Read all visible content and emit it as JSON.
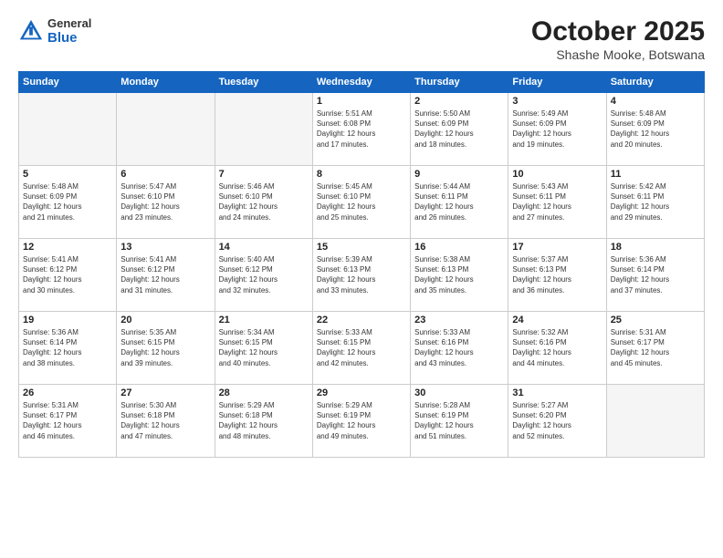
{
  "header": {
    "logo_general": "General",
    "logo_blue": "Blue",
    "month_title": "October 2025",
    "location": "Shashe Mooke, Botswana"
  },
  "days_of_week": [
    "Sunday",
    "Monday",
    "Tuesday",
    "Wednesday",
    "Thursday",
    "Friday",
    "Saturday"
  ],
  "weeks": [
    [
      {
        "day": "",
        "info": ""
      },
      {
        "day": "",
        "info": ""
      },
      {
        "day": "",
        "info": ""
      },
      {
        "day": "1",
        "info": "Sunrise: 5:51 AM\nSunset: 6:08 PM\nDaylight: 12 hours\nand 17 minutes."
      },
      {
        "day": "2",
        "info": "Sunrise: 5:50 AM\nSunset: 6:09 PM\nDaylight: 12 hours\nand 18 minutes."
      },
      {
        "day": "3",
        "info": "Sunrise: 5:49 AM\nSunset: 6:09 PM\nDaylight: 12 hours\nand 19 minutes."
      },
      {
        "day": "4",
        "info": "Sunrise: 5:48 AM\nSunset: 6:09 PM\nDaylight: 12 hours\nand 20 minutes."
      }
    ],
    [
      {
        "day": "5",
        "info": "Sunrise: 5:48 AM\nSunset: 6:09 PM\nDaylight: 12 hours\nand 21 minutes."
      },
      {
        "day": "6",
        "info": "Sunrise: 5:47 AM\nSunset: 6:10 PM\nDaylight: 12 hours\nand 23 minutes."
      },
      {
        "day": "7",
        "info": "Sunrise: 5:46 AM\nSunset: 6:10 PM\nDaylight: 12 hours\nand 24 minutes."
      },
      {
        "day": "8",
        "info": "Sunrise: 5:45 AM\nSunset: 6:10 PM\nDaylight: 12 hours\nand 25 minutes."
      },
      {
        "day": "9",
        "info": "Sunrise: 5:44 AM\nSunset: 6:11 PM\nDaylight: 12 hours\nand 26 minutes."
      },
      {
        "day": "10",
        "info": "Sunrise: 5:43 AM\nSunset: 6:11 PM\nDaylight: 12 hours\nand 27 minutes."
      },
      {
        "day": "11",
        "info": "Sunrise: 5:42 AM\nSunset: 6:11 PM\nDaylight: 12 hours\nand 29 minutes."
      }
    ],
    [
      {
        "day": "12",
        "info": "Sunrise: 5:41 AM\nSunset: 6:12 PM\nDaylight: 12 hours\nand 30 minutes."
      },
      {
        "day": "13",
        "info": "Sunrise: 5:41 AM\nSunset: 6:12 PM\nDaylight: 12 hours\nand 31 minutes."
      },
      {
        "day": "14",
        "info": "Sunrise: 5:40 AM\nSunset: 6:12 PM\nDaylight: 12 hours\nand 32 minutes."
      },
      {
        "day": "15",
        "info": "Sunrise: 5:39 AM\nSunset: 6:13 PM\nDaylight: 12 hours\nand 33 minutes."
      },
      {
        "day": "16",
        "info": "Sunrise: 5:38 AM\nSunset: 6:13 PM\nDaylight: 12 hours\nand 35 minutes."
      },
      {
        "day": "17",
        "info": "Sunrise: 5:37 AM\nSunset: 6:13 PM\nDaylight: 12 hours\nand 36 minutes."
      },
      {
        "day": "18",
        "info": "Sunrise: 5:36 AM\nSunset: 6:14 PM\nDaylight: 12 hours\nand 37 minutes."
      }
    ],
    [
      {
        "day": "19",
        "info": "Sunrise: 5:36 AM\nSunset: 6:14 PM\nDaylight: 12 hours\nand 38 minutes."
      },
      {
        "day": "20",
        "info": "Sunrise: 5:35 AM\nSunset: 6:15 PM\nDaylight: 12 hours\nand 39 minutes."
      },
      {
        "day": "21",
        "info": "Sunrise: 5:34 AM\nSunset: 6:15 PM\nDaylight: 12 hours\nand 40 minutes."
      },
      {
        "day": "22",
        "info": "Sunrise: 5:33 AM\nSunset: 6:15 PM\nDaylight: 12 hours\nand 42 minutes."
      },
      {
        "day": "23",
        "info": "Sunrise: 5:33 AM\nSunset: 6:16 PM\nDaylight: 12 hours\nand 43 minutes."
      },
      {
        "day": "24",
        "info": "Sunrise: 5:32 AM\nSunset: 6:16 PM\nDaylight: 12 hours\nand 44 minutes."
      },
      {
        "day": "25",
        "info": "Sunrise: 5:31 AM\nSunset: 6:17 PM\nDaylight: 12 hours\nand 45 minutes."
      }
    ],
    [
      {
        "day": "26",
        "info": "Sunrise: 5:31 AM\nSunset: 6:17 PM\nDaylight: 12 hours\nand 46 minutes."
      },
      {
        "day": "27",
        "info": "Sunrise: 5:30 AM\nSunset: 6:18 PM\nDaylight: 12 hours\nand 47 minutes."
      },
      {
        "day": "28",
        "info": "Sunrise: 5:29 AM\nSunset: 6:18 PM\nDaylight: 12 hours\nand 48 minutes."
      },
      {
        "day": "29",
        "info": "Sunrise: 5:29 AM\nSunset: 6:19 PM\nDaylight: 12 hours\nand 49 minutes."
      },
      {
        "day": "30",
        "info": "Sunrise: 5:28 AM\nSunset: 6:19 PM\nDaylight: 12 hours\nand 51 minutes."
      },
      {
        "day": "31",
        "info": "Sunrise: 5:27 AM\nSunset: 6:20 PM\nDaylight: 12 hours\nand 52 minutes."
      },
      {
        "day": "",
        "info": ""
      }
    ]
  ]
}
